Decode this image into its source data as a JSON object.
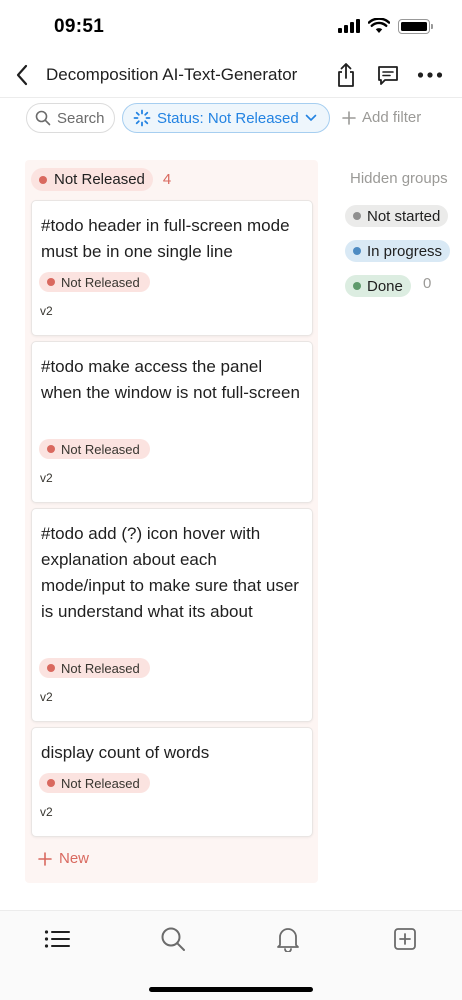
{
  "status_bar": {
    "time": "09:51"
  },
  "nav": {
    "title": "Decomposition AI-Text-Generator",
    "icons": [
      "back-chevron-icon",
      "share-icon",
      "comment-icon",
      "more-icon"
    ]
  },
  "filters": {
    "search_label": "Search",
    "status_label": "Status: Not Released",
    "add_filter_label": "Add filter"
  },
  "column": {
    "label": "Not Released",
    "count": "4",
    "color": "#d9695f",
    "new_label": "New",
    "cards": [
      {
        "title": "#todo header in full-screen mode must be in one single line",
        "tag": "Not Released",
        "version": "v2"
      },
      {
        "title": "#todo make access the panel when the window is not full-screen",
        "tag": "Not Released",
        "version": "v2"
      },
      {
        "title": "#todo add (?) icon hover with explanation about each mode/input to make sure that user is understand what its about",
        "tag": "Not Released",
        "version": "v2"
      },
      {
        "title": "display count of words",
        "tag": "Not Released",
        "version": "v2"
      }
    ]
  },
  "hidden_groups": {
    "title": "Hidden groups",
    "items": [
      {
        "label": "Not started",
        "color": "#8f8f8f",
        "bg": "#ebebea"
      },
      {
        "label": "In progress",
        "color": "#4e8bc2",
        "bg": "#d9e9f5"
      },
      {
        "label": "Done",
        "color": "#5f9a6c",
        "bg": "#dcede1"
      }
    ],
    "done_count": "0"
  },
  "tab_bar": {
    "icons": [
      "list-icon",
      "search-icon",
      "bell-icon",
      "new-page-icon"
    ]
  }
}
